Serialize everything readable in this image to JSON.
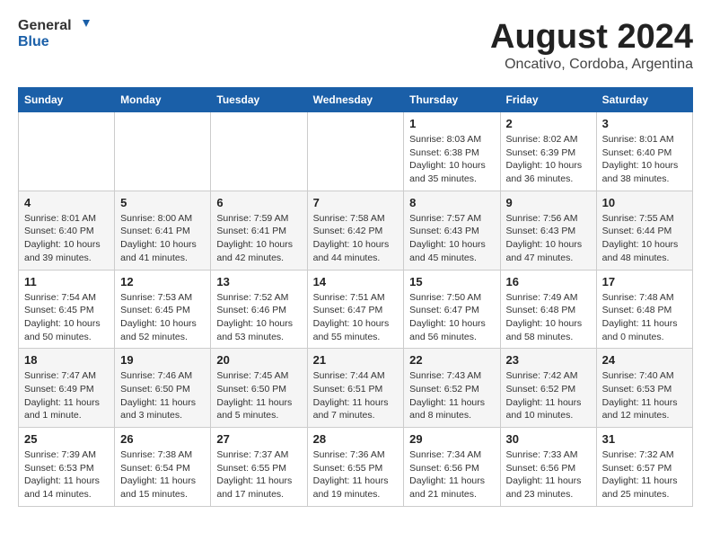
{
  "header": {
    "logo_general": "General",
    "logo_blue": "Blue",
    "month_year": "August 2024",
    "location": "Oncativo, Cordoba, Argentina"
  },
  "weekdays": [
    "Sunday",
    "Monday",
    "Tuesday",
    "Wednesday",
    "Thursday",
    "Friday",
    "Saturday"
  ],
  "weeks": [
    [
      {
        "day": "",
        "info": ""
      },
      {
        "day": "",
        "info": ""
      },
      {
        "day": "",
        "info": ""
      },
      {
        "day": "",
        "info": ""
      },
      {
        "day": "1",
        "info": "Sunrise: 8:03 AM\nSunset: 6:38 PM\nDaylight: 10 hours\nand 35 minutes."
      },
      {
        "day": "2",
        "info": "Sunrise: 8:02 AM\nSunset: 6:39 PM\nDaylight: 10 hours\nand 36 minutes."
      },
      {
        "day": "3",
        "info": "Sunrise: 8:01 AM\nSunset: 6:40 PM\nDaylight: 10 hours\nand 38 minutes."
      }
    ],
    [
      {
        "day": "4",
        "info": "Sunrise: 8:01 AM\nSunset: 6:40 PM\nDaylight: 10 hours\nand 39 minutes."
      },
      {
        "day": "5",
        "info": "Sunrise: 8:00 AM\nSunset: 6:41 PM\nDaylight: 10 hours\nand 41 minutes."
      },
      {
        "day": "6",
        "info": "Sunrise: 7:59 AM\nSunset: 6:41 PM\nDaylight: 10 hours\nand 42 minutes."
      },
      {
        "day": "7",
        "info": "Sunrise: 7:58 AM\nSunset: 6:42 PM\nDaylight: 10 hours\nand 44 minutes."
      },
      {
        "day": "8",
        "info": "Sunrise: 7:57 AM\nSunset: 6:43 PM\nDaylight: 10 hours\nand 45 minutes."
      },
      {
        "day": "9",
        "info": "Sunrise: 7:56 AM\nSunset: 6:43 PM\nDaylight: 10 hours\nand 47 minutes."
      },
      {
        "day": "10",
        "info": "Sunrise: 7:55 AM\nSunset: 6:44 PM\nDaylight: 10 hours\nand 48 minutes."
      }
    ],
    [
      {
        "day": "11",
        "info": "Sunrise: 7:54 AM\nSunset: 6:45 PM\nDaylight: 10 hours\nand 50 minutes."
      },
      {
        "day": "12",
        "info": "Sunrise: 7:53 AM\nSunset: 6:45 PM\nDaylight: 10 hours\nand 52 minutes."
      },
      {
        "day": "13",
        "info": "Sunrise: 7:52 AM\nSunset: 6:46 PM\nDaylight: 10 hours\nand 53 minutes."
      },
      {
        "day": "14",
        "info": "Sunrise: 7:51 AM\nSunset: 6:47 PM\nDaylight: 10 hours\nand 55 minutes."
      },
      {
        "day": "15",
        "info": "Sunrise: 7:50 AM\nSunset: 6:47 PM\nDaylight: 10 hours\nand 56 minutes."
      },
      {
        "day": "16",
        "info": "Sunrise: 7:49 AM\nSunset: 6:48 PM\nDaylight: 10 hours\nand 58 minutes."
      },
      {
        "day": "17",
        "info": "Sunrise: 7:48 AM\nSunset: 6:48 PM\nDaylight: 11 hours\nand 0 minutes."
      }
    ],
    [
      {
        "day": "18",
        "info": "Sunrise: 7:47 AM\nSunset: 6:49 PM\nDaylight: 11 hours\nand 1 minute."
      },
      {
        "day": "19",
        "info": "Sunrise: 7:46 AM\nSunset: 6:50 PM\nDaylight: 11 hours\nand 3 minutes."
      },
      {
        "day": "20",
        "info": "Sunrise: 7:45 AM\nSunset: 6:50 PM\nDaylight: 11 hours\nand 5 minutes."
      },
      {
        "day": "21",
        "info": "Sunrise: 7:44 AM\nSunset: 6:51 PM\nDaylight: 11 hours\nand 7 minutes."
      },
      {
        "day": "22",
        "info": "Sunrise: 7:43 AM\nSunset: 6:52 PM\nDaylight: 11 hours\nand 8 minutes."
      },
      {
        "day": "23",
        "info": "Sunrise: 7:42 AM\nSunset: 6:52 PM\nDaylight: 11 hours\nand 10 minutes."
      },
      {
        "day": "24",
        "info": "Sunrise: 7:40 AM\nSunset: 6:53 PM\nDaylight: 11 hours\nand 12 minutes."
      }
    ],
    [
      {
        "day": "25",
        "info": "Sunrise: 7:39 AM\nSunset: 6:53 PM\nDaylight: 11 hours\nand 14 minutes."
      },
      {
        "day": "26",
        "info": "Sunrise: 7:38 AM\nSunset: 6:54 PM\nDaylight: 11 hours\nand 15 minutes."
      },
      {
        "day": "27",
        "info": "Sunrise: 7:37 AM\nSunset: 6:55 PM\nDaylight: 11 hours\nand 17 minutes."
      },
      {
        "day": "28",
        "info": "Sunrise: 7:36 AM\nSunset: 6:55 PM\nDaylight: 11 hours\nand 19 minutes."
      },
      {
        "day": "29",
        "info": "Sunrise: 7:34 AM\nSunset: 6:56 PM\nDaylight: 11 hours\nand 21 minutes."
      },
      {
        "day": "30",
        "info": "Sunrise: 7:33 AM\nSunset: 6:56 PM\nDaylight: 11 hours\nand 23 minutes."
      },
      {
        "day": "31",
        "info": "Sunrise: 7:32 AM\nSunset: 6:57 PM\nDaylight: 11 hours\nand 25 minutes."
      }
    ]
  ]
}
